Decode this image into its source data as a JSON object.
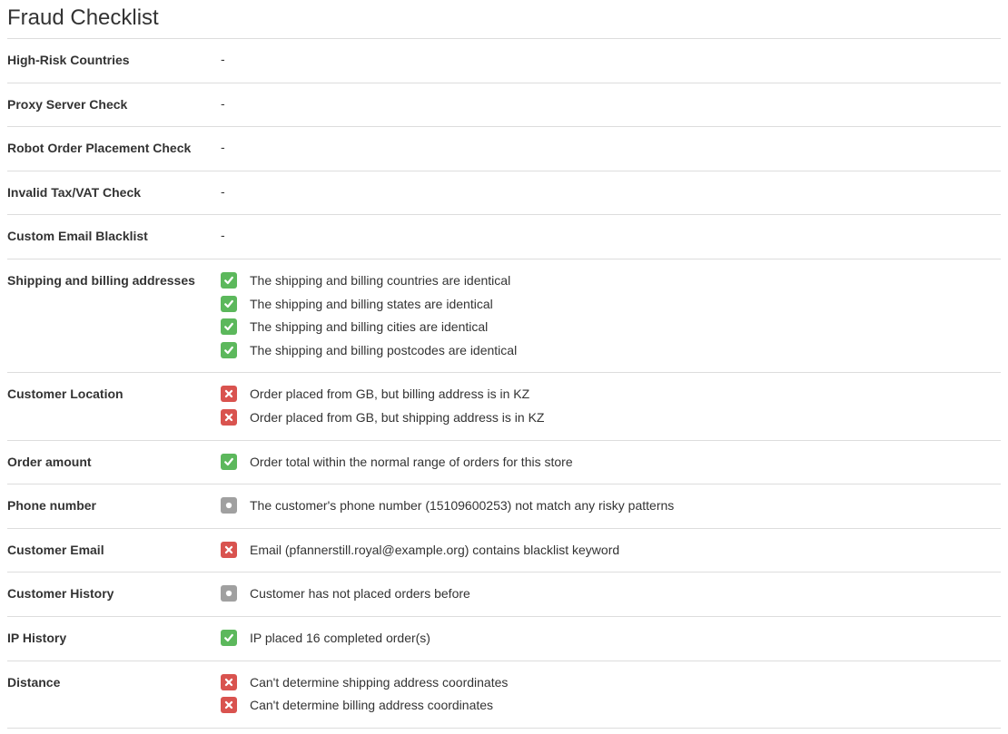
{
  "title": "Fraud Checklist",
  "rows": [
    {
      "label": "High-Risk Countries",
      "items": null
    },
    {
      "label": "Proxy Server Check",
      "items": null
    },
    {
      "label": "Robot Order Placement Check",
      "items": null
    },
    {
      "label": "Invalid Tax/VAT Check",
      "items": null
    },
    {
      "label": "Custom Email Blacklist",
      "items": null
    },
    {
      "label": "Shipping and billing addresses",
      "items": [
        {
          "status": "pass",
          "text": "The shipping and billing countries are identical"
        },
        {
          "status": "pass",
          "text": "The shipping and billing states are identical"
        },
        {
          "status": "pass",
          "text": "The shipping and billing cities are identical"
        },
        {
          "status": "pass",
          "text": "The shipping and billing postcodes are identical"
        }
      ]
    },
    {
      "label": "Customer Location",
      "items": [
        {
          "status": "fail",
          "text": "Order placed from GB, but billing address is in KZ"
        },
        {
          "status": "fail",
          "text": "Order placed from GB, but shipping address is in KZ"
        }
      ]
    },
    {
      "label": "Order amount",
      "items": [
        {
          "status": "pass",
          "text": "Order total within the normal range of orders for this store"
        }
      ]
    },
    {
      "label": "Phone number",
      "items": [
        {
          "status": "neutral",
          "text": "The customer's phone number (15109600253) not match any risky patterns"
        }
      ]
    },
    {
      "label": "Customer Email",
      "items": [
        {
          "status": "fail",
          "text": "Email (pfannerstill.royal@example.org) contains blacklist keyword"
        }
      ]
    },
    {
      "label": "Customer History",
      "items": [
        {
          "status": "neutral",
          "text": "Customer has not placed orders before"
        }
      ]
    },
    {
      "label": "IP History",
      "items": [
        {
          "status": "pass",
          "text": "IP placed 16 completed order(s)"
        }
      ]
    },
    {
      "label": "Distance",
      "items": [
        {
          "status": "fail",
          "text": "Can't determine shipping address coordinates"
        },
        {
          "status": "fail",
          "text": "Can't determine billing address coordinates"
        }
      ]
    }
  ]
}
